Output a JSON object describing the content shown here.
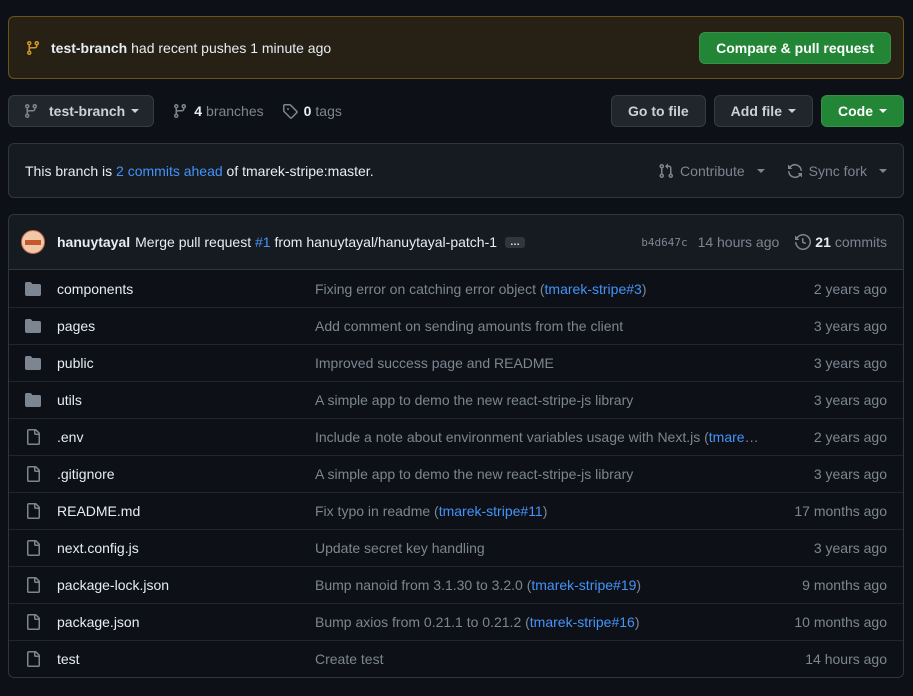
{
  "banner": {
    "branch": "test-branch",
    "text": " had recent pushes 1 minute ago",
    "button": "Compare & pull request"
  },
  "toolbar": {
    "branch_button": "test-branch",
    "branches_count": "4",
    "branches_label": "branches",
    "tags_count": "0",
    "tags_label": "tags",
    "go_to_file": "Go to file",
    "add_file": "Add file",
    "code": "Code"
  },
  "ahead": {
    "prefix": "This branch is ",
    "link": "2 commits ahead",
    "suffix": " of tmarek-stripe:master.",
    "contribute": "Contribute",
    "sync": "Sync fork"
  },
  "commit": {
    "author": "hanuytayal",
    "msg_prefix": "Merge pull request ",
    "pr": "#1",
    "msg_suffix": " from hanuytayal/hanuytayal-patch-1",
    "ellipsis": "…",
    "sha": "b4d647c",
    "time": "14 hours ago",
    "count": "21",
    "count_label": "commits"
  },
  "files": [
    {
      "name": "components",
      "type": "folder",
      "msg": "Fixing error on catching error object (",
      "ref": "tmarek-stripe#3",
      "msg_end": ")",
      "time": "2 years ago"
    },
    {
      "name": "pages",
      "type": "folder",
      "msg": "Add comment on sending amounts from the client",
      "ref": "",
      "msg_end": "",
      "time": "3 years ago"
    },
    {
      "name": "public",
      "type": "folder",
      "msg": "Improved success page and README",
      "ref": "",
      "msg_end": "",
      "time": "3 years ago"
    },
    {
      "name": "utils",
      "type": "folder",
      "msg": "A simple app to demo the new react-stripe-js library",
      "ref": "",
      "msg_end": "",
      "time": "3 years ago"
    },
    {
      "name": ".env",
      "type": "file",
      "msg": "Include a note about environment variables usage with Next.js (",
      "ref": "tmarek…",
      "msg_end": "",
      "time": "2 years ago"
    },
    {
      "name": ".gitignore",
      "type": "file",
      "msg": "A simple app to demo the new react-stripe-js library",
      "ref": "",
      "msg_end": "",
      "time": "3 years ago"
    },
    {
      "name": "README.md",
      "type": "file",
      "msg": "Fix typo in readme (",
      "ref": "tmarek-stripe#11",
      "msg_end": ")",
      "time": "17 months ago"
    },
    {
      "name": "next.config.js",
      "type": "file",
      "msg": "Update secret key handling",
      "ref": "",
      "msg_end": "",
      "time": "3 years ago"
    },
    {
      "name": "package-lock.json",
      "type": "file",
      "msg": "Bump nanoid from 3.1.30 to 3.2.0 (",
      "ref": "tmarek-stripe#19",
      "msg_end": ")",
      "time": "9 months ago"
    },
    {
      "name": "package.json",
      "type": "file",
      "msg": "Bump axios from 0.21.1 to 0.21.2 (",
      "ref": "tmarek-stripe#16",
      "msg_end": ")",
      "time": "10 months ago"
    },
    {
      "name": "test",
      "type": "file",
      "msg": "Create test",
      "ref": "",
      "msg_end": "",
      "time": "14 hours ago"
    }
  ]
}
